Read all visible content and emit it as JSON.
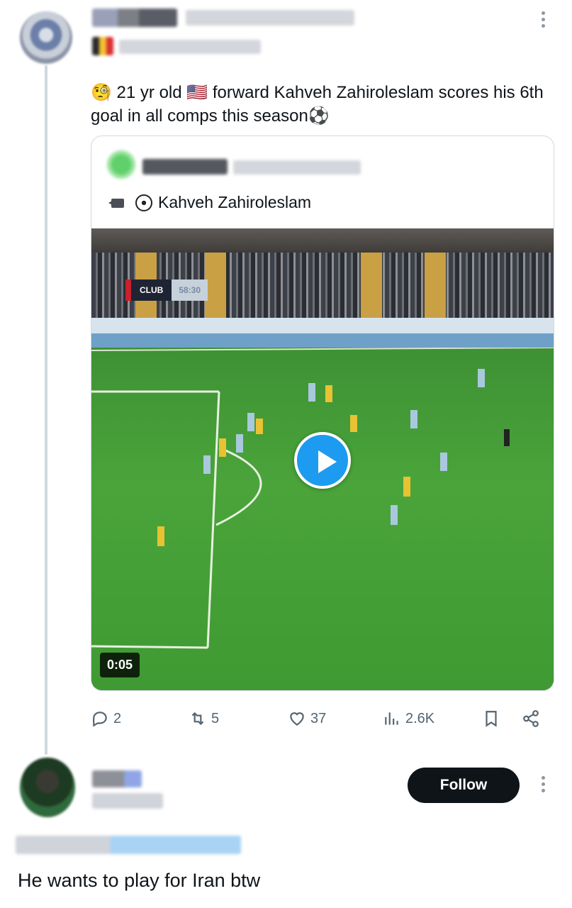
{
  "post": {
    "text_prefix": "🧐 21 yr old 🇺🇸 forward Kahveh Zahiroleslam scores his 6th goal in all comps this season",
    "text_suffix": "⚽"
  },
  "quote": {
    "title": "Kahveh Zahiroleslam",
    "title_icons": [
      "video-camera-icon",
      "soccer-ball-icon"
    ]
  },
  "video": {
    "scoreboard_club": "CLUB",
    "scoreboard_time": "58:30",
    "duration": "0:05"
  },
  "actions": {
    "replies": "2",
    "reposts": "5",
    "likes": "37",
    "views": "2.6K"
  },
  "reply": {
    "follow_label": "Follow",
    "text": "He wants to play for Iran btw"
  },
  "colors": {
    "accent": "#1d9bf0",
    "text": "#0f1419",
    "muted": "#536471",
    "border": "#cfd9de"
  }
}
